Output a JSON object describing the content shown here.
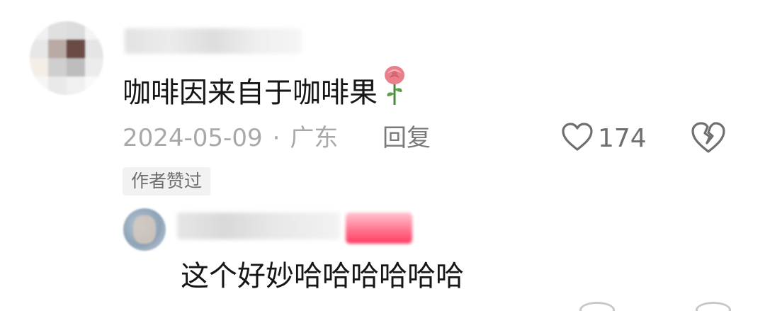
{
  "comment": {
    "username": "",
    "text": "咖啡因来自于咖啡果",
    "emoji_icon": "rose-icon",
    "date": "2024-05-09",
    "separator": "·",
    "location": "广东",
    "reply_label": "回复",
    "like_count": "174",
    "author_liked_label": "作者赞过"
  },
  "reply": {
    "username": "",
    "badge": "",
    "text": "这个好妙哈哈哈哈哈哈"
  },
  "colors": {
    "meta_text": "#a8a8a8",
    "reply_button": "#7a7a7a",
    "author_badge": "#ff3d62",
    "badge_bg": "#f2f2f2"
  }
}
